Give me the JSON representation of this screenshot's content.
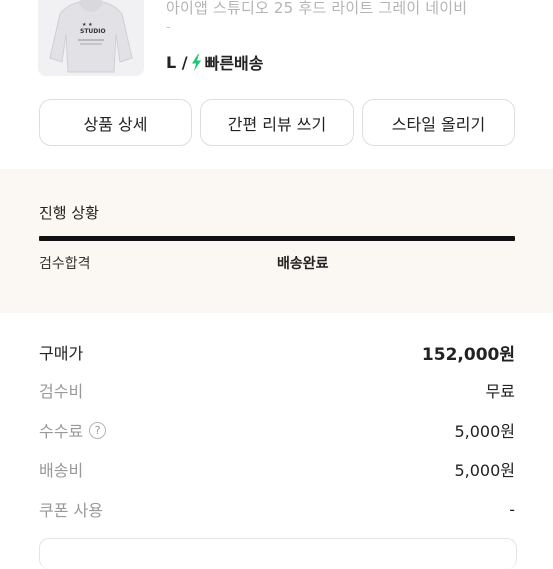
{
  "product": {
    "title": "아이앱 스튜디오 25 후드 라이트 그레이 네이비",
    "dash": "-",
    "option_size": "L /",
    "delivery_label": "빠른배송",
    "bolt_color": "#1ec677"
  },
  "actions": {
    "detail": "상품 상세",
    "review": "간편 리뷰 쓰기",
    "style": "스타일 올리기"
  },
  "progress": {
    "title": "진행 상황",
    "step_label": "검수합격",
    "status": "배송완료",
    "fill_fraction": 1.0,
    "panel_color": "#fbf7f2"
  },
  "fees": {
    "purchase_label": "구매가",
    "purchase_value": "152,000원",
    "inspection_label": "검수비",
    "inspection_value": "무료",
    "commission_label": "수수료",
    "commission_help": "?",
    "commission_value": "5,000원",
    "shipping_label": "배송비",
    "shipping_value": "5,000원",
    "coupon_label": "쿠폰 사용",
    "coupon_value": "-"
  }
}
